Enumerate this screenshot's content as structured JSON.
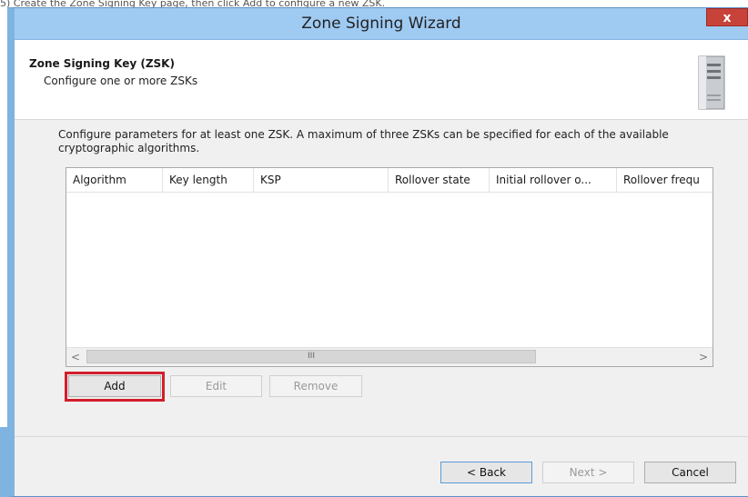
{
  "page_caption": "5) Create the Zone Signing Key page, then click Add to configure a new ZSK.",
  "window": {
    "title": "Zone Signing Wizard",
    "close_glyph": "x"
  },
  "header": {
    "title": "Zone Signing Key (ZSK)",
    "subtitle": "Configure one or more ZSKs"
  },
  "description": "Configure parameters for at least one ZSK. A maximum of three ZSKs can be specified for each of the available cryptographic algorithms.",
  "table": {
    "columns": [
      "Algorithm",
      "Key length",
      "KSP",
      "Rollover state",
      "Initial rollover o...",
      "Rollover frequ"
    ],
    "rows": []
  },
  "scrollbar": {
    "left_arrow": "<",
    "right_arrow": ">",
    "thumb_grip": "III"
  },
  "buttons": {
    "add": "Add",
    "edit": "Edit",
    "remove": "Remove",
    "back": "< Back",
    "next": "Next >",
    "cancel": "Cancel"
  },
  "colors": {
    "titlebar": "#9fcaf2",
    "close_button": "#c7433a",
    "highlight": "#d21e2b"
  }
}
